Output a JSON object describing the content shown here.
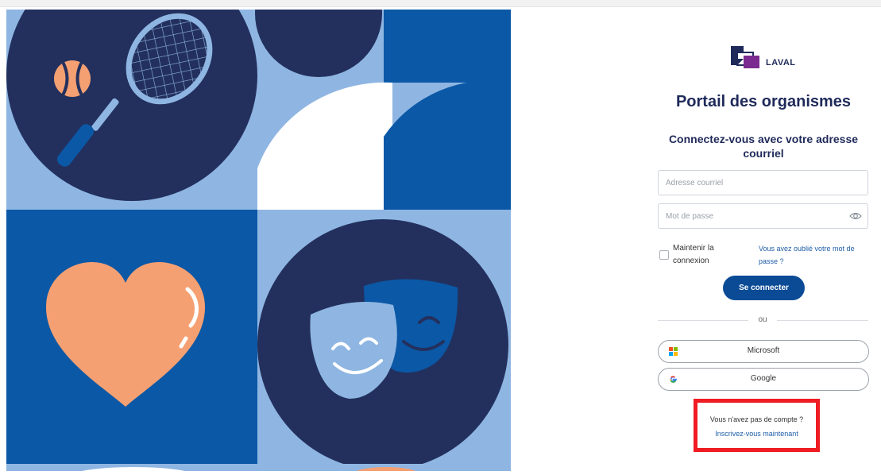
{
  "brand": {
    "logo_text": "LAVAL"
  },
  "page": {
    "title": "Portail des organismes",
    "subtitle": "Connectez-vous avec votre adresse courriel"
  },
  "form": {
    "email_placeholder": "Adresse courriel",
    "email_value": "",
    "password_placeholder": "Mot de passe",
    "password_value": "",
    "remember_label": "Maintenir la connexion",
    "remember_checked": false,
    "forgot_link": "Vous avez oublié votre mot de passe ?",
    "login_button": "Se connecter"
  },
  "divider": {
    "text": "ou"
  },
  "sso": {
    "microsoft_label": "Microsoft",
    "google_label": "Google"
  },
  "signup": {
    "question": "Vous n'avez pas de compte ?",
    "link": "Inscrivez-vous maintenant"
  },
  "icons": {
    "eye": "eye-icon",
    "microsoft": "microsoft-logo-icon",
    "google": "google-logo-icon",
    "tennis_racket": "tennis-racket-icon",
    "tennis_ball": "tennis-ball-icon",
    "heart": "heart-icon",
    "theater_masks": "theater-masks-icon"
  },
  "colors": {
    "navy": "#23305e",
    "royal_blue": "#0b58a6",
    "light_blue": "#8fb6e2",
    "orange": "#f5a072",
    "primary_button": "#0b4b96",
    "link": "#1f5ea8",
    "highlight_box": "#ef1c24"
  }
}
